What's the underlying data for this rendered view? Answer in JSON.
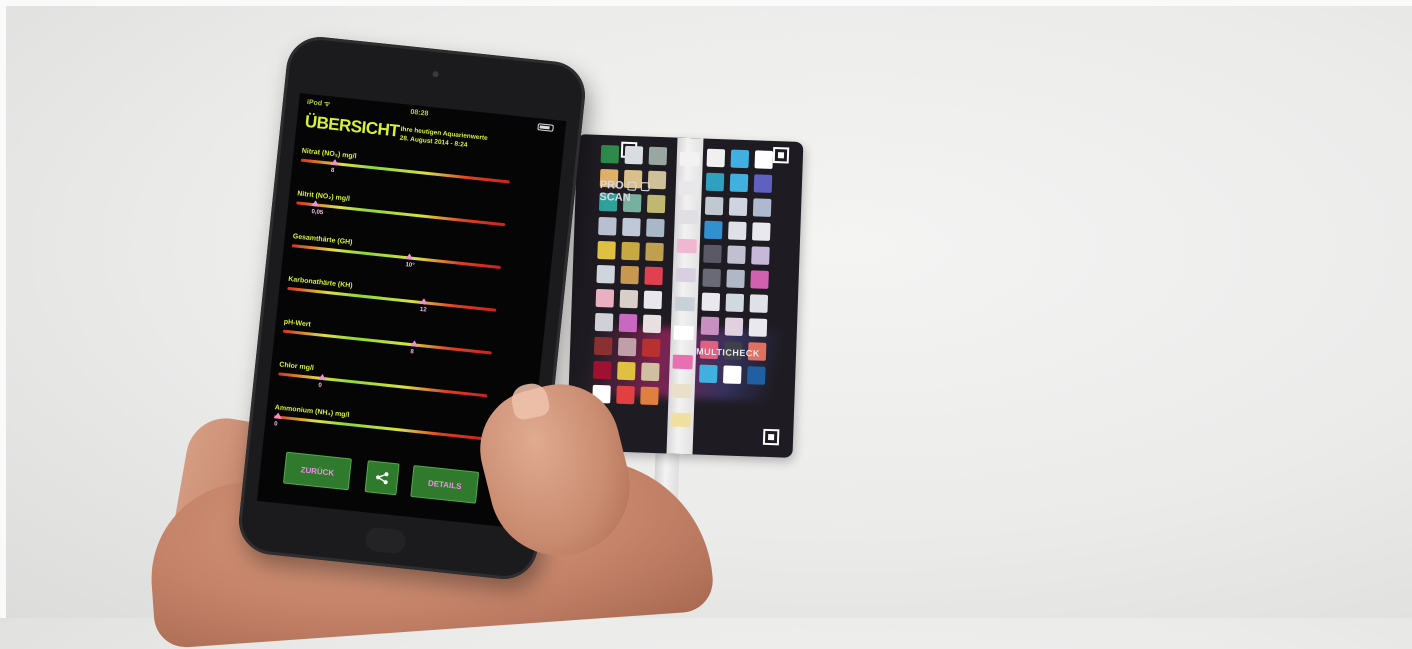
{
  "app": {
    "status": {
      "carrier": "iPod ᯤ",
      "time": "08:28"
    },
    "title": "ÜBERSICHT",
    "subtitle_line1": "Ihre heutigen Aquarienwerte",
    "subtitle_line2": "28. August 2014 - 8:24",
    "parameters": [
      {
        "label": "Nitrat (NO₃) mg/l",
        "marker": 0.16,
        "value": "8"
      },
      {
        "label": "Nitrit (NO₂) mg/l",
        "marker": 0.09,
        "value": "0,05"
      },
      {
        "label": "Gesamthärte (GH)",
        "marker": 0.56,
        "value": "10°"
      },
      {
        "label": "Karbonathärte (KH)",
        "marker": 0.65,
        "value": "12"
      },
      {
        "label": "pH-Wert",
        "marker": 0.63,
        "value": "8"
      },
      {
        "label": "Chlor mg/l",
        "marker": 0.21,
        "value": "0"
      },
      {
        "label": "Ammonium (NH₄) mg/l",
        "marker": 0.02,
        "value": "0"
      }
    ],
    "buttons": {
      "back": "ZURÜCK",
      "details": "DETAILS"
    },
    "colors": {
      "accent": "#d8f03a",
      "button_bg": "#2f7a2c",
      "button_text": "#ee90e4"
    }
  },
  "card": {
    "brand_line1": "PRO ▢ ▢",
    "brand_line2": "SCAN",
    "label": "MULTICHECK",
    "left_swatches": [
      "#2e8a4a",
      "#d9dde2",
      "#9aa6a0",
      "#e0b06a",
      "#d9c08a",
      "#cfc09a",
      "#2fa09a",
      "#78b0a0",
      "#c0b870",
      "#b8c0d0",
      "#c0c8d8",
      "#a8b8c8",
      "#e0c040",
      "#c8a840",
      "#c0a050",
      "#d0d4dc",
      "#c89850",
      "#e04050",
      "#e8b0c0",
      "#d8d0c8",
      "#e8e8ec",
      "#d0d0d8",
      "#c868c0",
      "#e8e0e0",
      "#8a3030",
      "#c0a0a8",
      "#b83030",
      "#a01030",
      "#e0c040",
      "#d0c0a0",
      "#ffffff",
      "#e04040",
      "#e08040"
    ],
    "right_swatches": [
      "#f0f0f0",
      "#40b0e0",
      "#ffffff",
      "#30a0c0",
      "#40b0e0",
      "#6060c0",
      "#c0c8d0",
      "#d0d4e0",
      "#b0b8d0",
      "#3090d0",
      "#e0e0e8",
      "#e8e8ee",
      "#5a5a66",
      "#c0c0d0",
      "#c8b8d8",
      "#6a6a76",
      "#b0b8c8",
      "#d060b0",
      "#e8e8ee",
      "#d0d8e0",
      "#e0e0e8",
      "#c890c0",
      "#e0d0e0",
      "#e8e8ee",
      "#e06080",
      "#404048",
      "#e07060",
      "#40b0e0",
      "#ffffff",
      "#2060a0"
    ],
    "strip_pads": [
      "#f2f2f2",
      "#e8e8ea",
      "#e0e0e4",
      "#f0b8d0",
      "#d8d0e0",
      "#c8d0d8",
      "#ffffff",
      "#e870b0",
      "#e8e0c8",
      "#f0e0a0"
    ]
  }
}
